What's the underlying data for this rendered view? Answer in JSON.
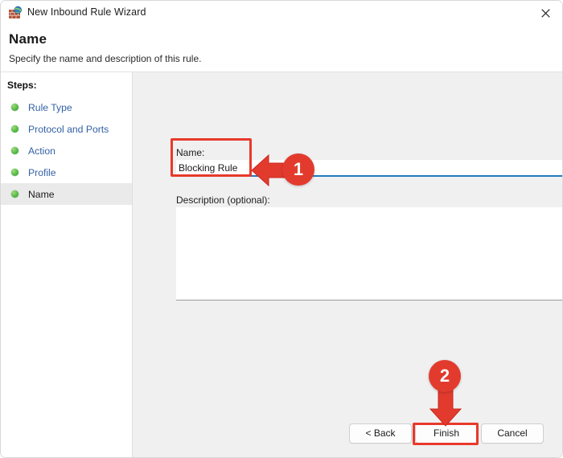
{
  "window": {
    "title": "New Inbound Rule Wizard",
    "icon": "firewall-icon",
    "close_icon": "close-icon"
  },
  "header": {
    "title": "Name",
    "subtitle": "Specify the name and description of this rule."
  },
  "sidebar": {
    "label": "Steps:",
    "items": [
      {
        "label": "Rule Type",
        "bullet": "green-dot-icon",
        "current": false
      },
      {
        "label": "Protocol and Ports",
        "bullet": "green-dot-icon",
        "current": false
      },
      {
        "label": "Action",
        "bullet": "green-dot-icon",
        "current": false
      },
      {
        "label": "Profile",
        "bullet": "green-dot-icon",
        "current": false
      },
      {
        "label": "Name",
        "bullet": "green-dot-icon",
        "current": true
      }
    ]
  },
  "main": {
    "name_label": "Name:",
    "name_value": "Blocking Rule",
    "name_placeholder": "",
    "description_label": "Description (optional):",
    "description_value": "",
    "description_placeholder": ""
  },
  "footer": {
    "back_label": "< Back",
    "finish_label": "Finish",
    "cancel_label": "Cancel"
  },
  "annotations": [
    {
      "number": "1",
      "target": "name-input",
      "arrow": "arrow-left-icon"
    },
    {
      "number": "2",
      "target": "finish-button",
      "arrow": "arrow-down-icon"
    }
  ],
  "colors": {
    "accent_blue": "#1e7ac0",
    "link_blue": "#3361a5",
    "annotation_red": "#e23b2e",
    "step_done_green": "#56b94a",
    "panel_gray": "#f0f0f0"
  }
}
